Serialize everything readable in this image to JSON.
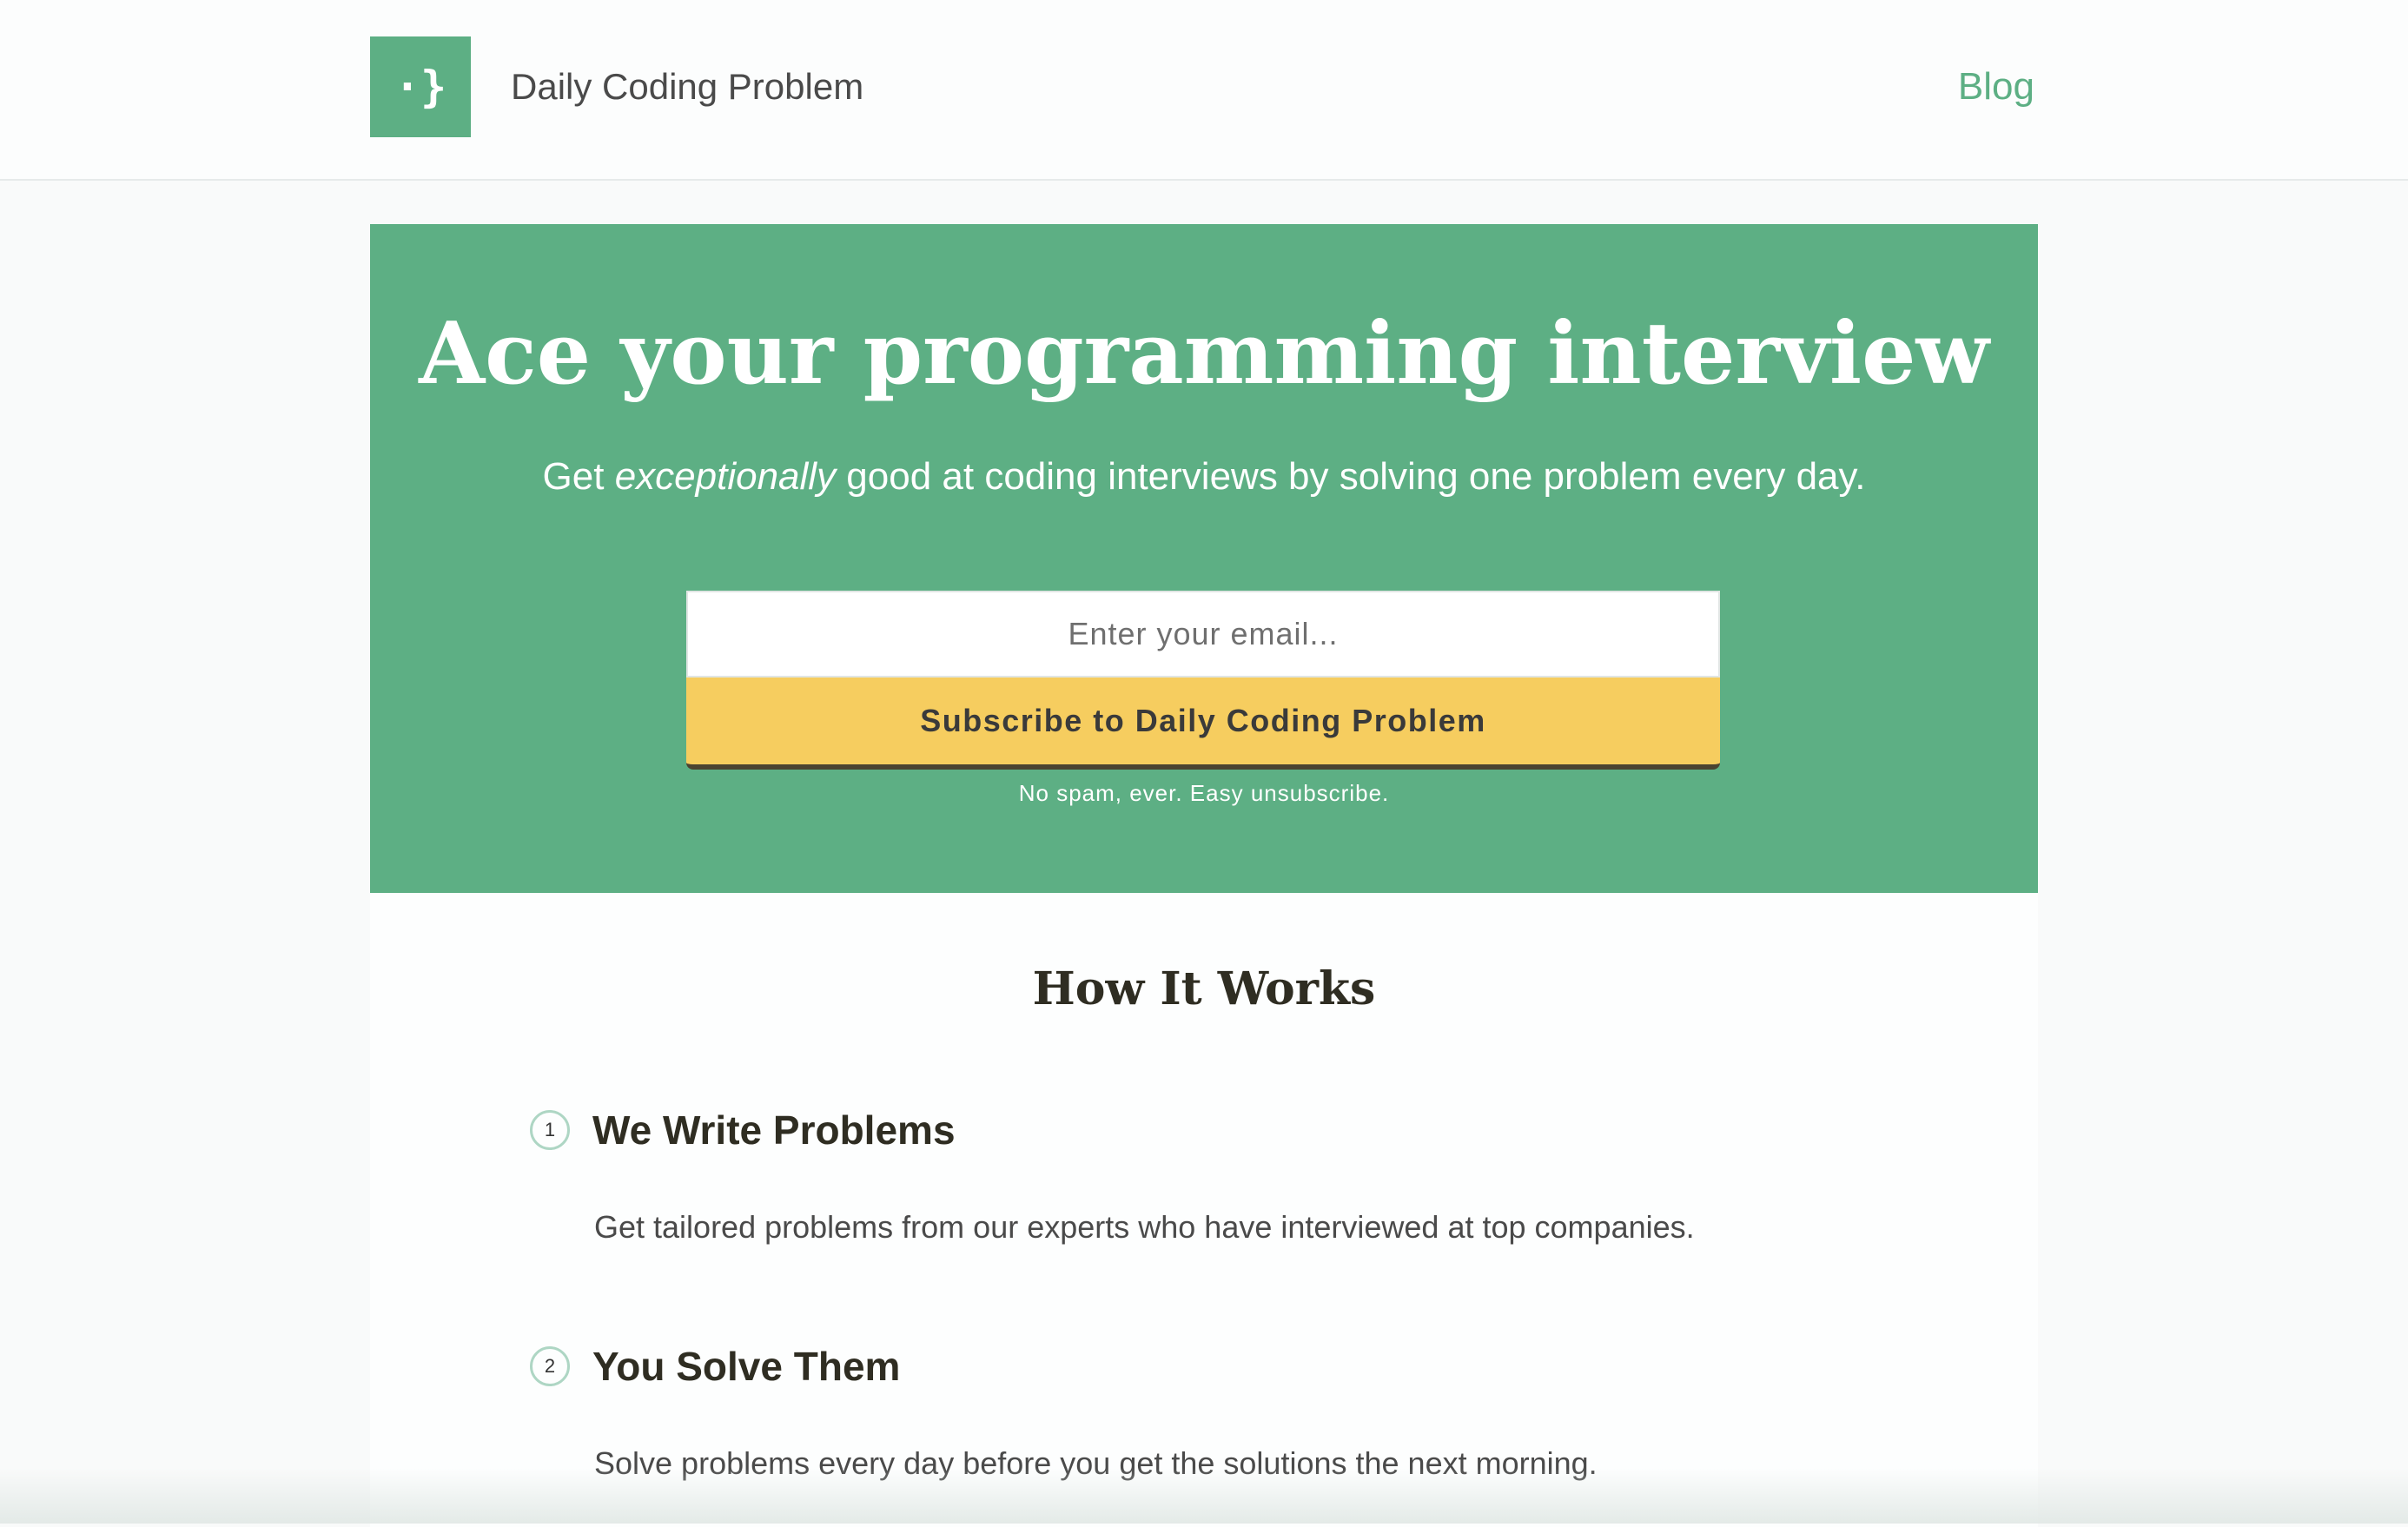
{
  "header": {
    "logo_glyph": "·}",
    "brand_name": "Daily Coding Problem",
    "blog_link": "Blog"
  },
  "hero": {
    "title": "Ace your programming interview",
    "subtitle_pre": "Get ",
    "subtitle_emphasis": "exceptionally",
    "subtitle_post": " good at coding interviews by solving one problem every day.",
    "email_placeholder": "Enter your email...",
    "subscribe_label": "Subscribe to Daily Coding Problem",
    "no_spam": "No spam, ever. Easy unsubscribe."
  },
  "how_it_works": {
    "title": "How It Works",
    "steps": [
      {
        "number": "1",
        "heading": "We Write Problems",
        "description": "Get tailored problems from our experts who have interviewed at top companies."
      },
      {
        "number": "2",
        "heading": "You Solve Them",
        "description": "Solve problems every day before you get the solutions the next morning."
      }
    ]
  },
  "colors": {
    "brand_green": "#5daf84",
    "button_yellow": "#f6cd5f",
    "heading_dark": "#2f2d22"
  }
}
